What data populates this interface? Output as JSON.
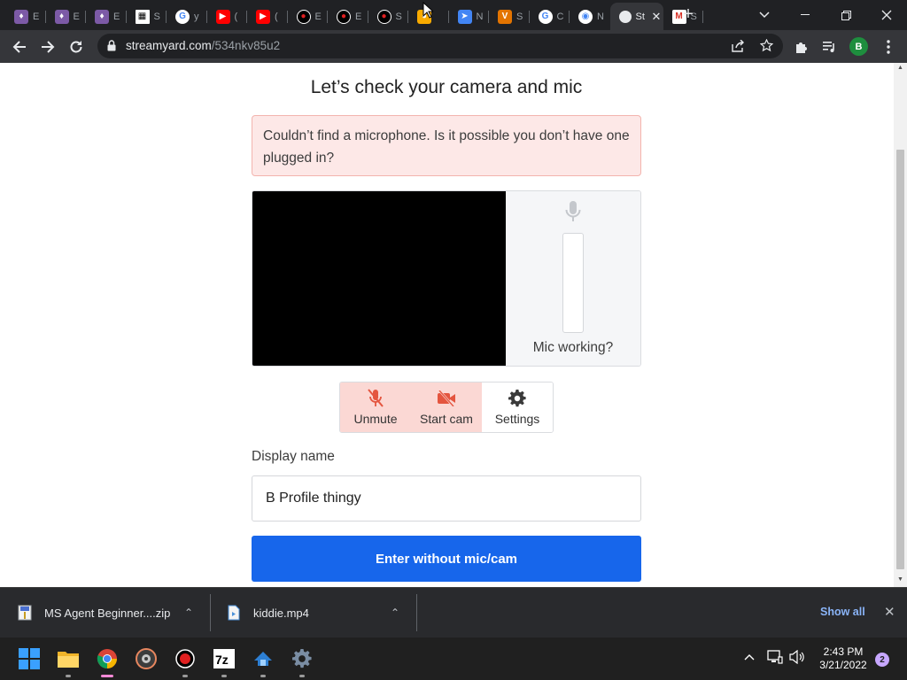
{
  "browser": {
    "tabs": [
      {
        "favicon": "wizard-icon",
        "title": "E",
        "color": "#7c5aa6",
        "glyph": "♦"
      },
      {
        "favicon": "wizard-icon",
        "title": "E",
        "color": "#7c5aa6",
        "glyph": "♦"
      },
      {
        "favicon": "wizard-icon",
        "title": "E",
        "color": "#7c5aa6",
        "glyph": "♦"
      },
      {
        "favicon": "qr-icon",
        "title": "S",
        "color": "#ffffff",
        "glyph": "▦"
      },
      {
        "favicon": "google-icon",
        "title": "y",
        "color": "#ffffff",
        "glyph": "G"
      },
      {
        "favicon": "youtube-icon",
        "title": "(",
        "color": "#ff0000",
        "glyph": "▶"
      },
      {
        "favicon": "youtube-icon",
        "title": "(",
        "color": "#ff0000",
        "glyph": "▶"
      },
      {
        "favicon": "record-icon",
        "title": "E",
        "color": "#d93025",
        "glyph": "●"
      },
      {
        "favicon": "record-icon",
        "title": "E",
        "color": "#d93025",
        "glyph": "●"
      },
      {
        "favicon": "record-icon",
        "title": "S",
        "color": "#d93025",
        "glyph": "●"
      },
      {
        "favicon": "colorful-icon",
        "title": "",
        "color": "#f9ab00",
        "glyph": "●"
      },
      {
        "favicon": "fish-icon",
        "title": "N",
        "color": "#4285f4",
        "glyph": "➤"
      },
      {
        "favicon": "v-icon",
        "title": "S",
        "color": "#e37400",
        "glyph": "V"
      },
      {
        "favicon": "google-icon",
        "title": "C",
        "color": "#ffffff",
        "glyph": "G"
      },
      {
        "favicon": "chrome-icon",
        "title": "N",
        "color": "#ffffff",
        "glyph": "◉"
      },
      {
        "favicon": "streamyard-icon",
        "title": "St",
        "color": "#35363a",
        "glyph": "",
        "active": true
      },
      {
        "favicon": "gmail-icon",
        "title": "S",
        "color": "#ffffff",
        "glyph": "M"
      }
    ],
    "url_host": "streamyard.com",
    "url_path": "/534nkv85u2"
  },
  "page": {
    "heading": "Let’s check your camera and mic",
    "alert": "Couldn’t find a microphone. Is it possible you don’t have one plugged in?",
    "mic_working": "Mic working?",
    "controls": {
      "unmute": "Unmute",
      "start_cam": "Start cam",
      "settings": "Settings"
    },
    "display_name_label": "Display name",
    "display_name_value": "B Profile thingy",
    "enter_button": "Enter without mic/cam"
  },
  "downloads": {
    "items": [
      {
        "name": "MS Agent Beginner....zip",
        "icon": "zip-icon"
      },
      {
        "name": "kiddie.mp4",
        "icon": "video-file-icon"
      }
    ],
    "show_all": "Show all"
  },
  "taskbar": {
    "time": "2:43 PM",
    "date": "3/21/2022",
    "notifications": "2"
  },
  "colors": {
    "accent": "#1766eb",
    "alert_bg": "#fde8e7",
    "warn_control": "#fbd8d4",
    "warn_icon": "#e4553f"
  }
}
